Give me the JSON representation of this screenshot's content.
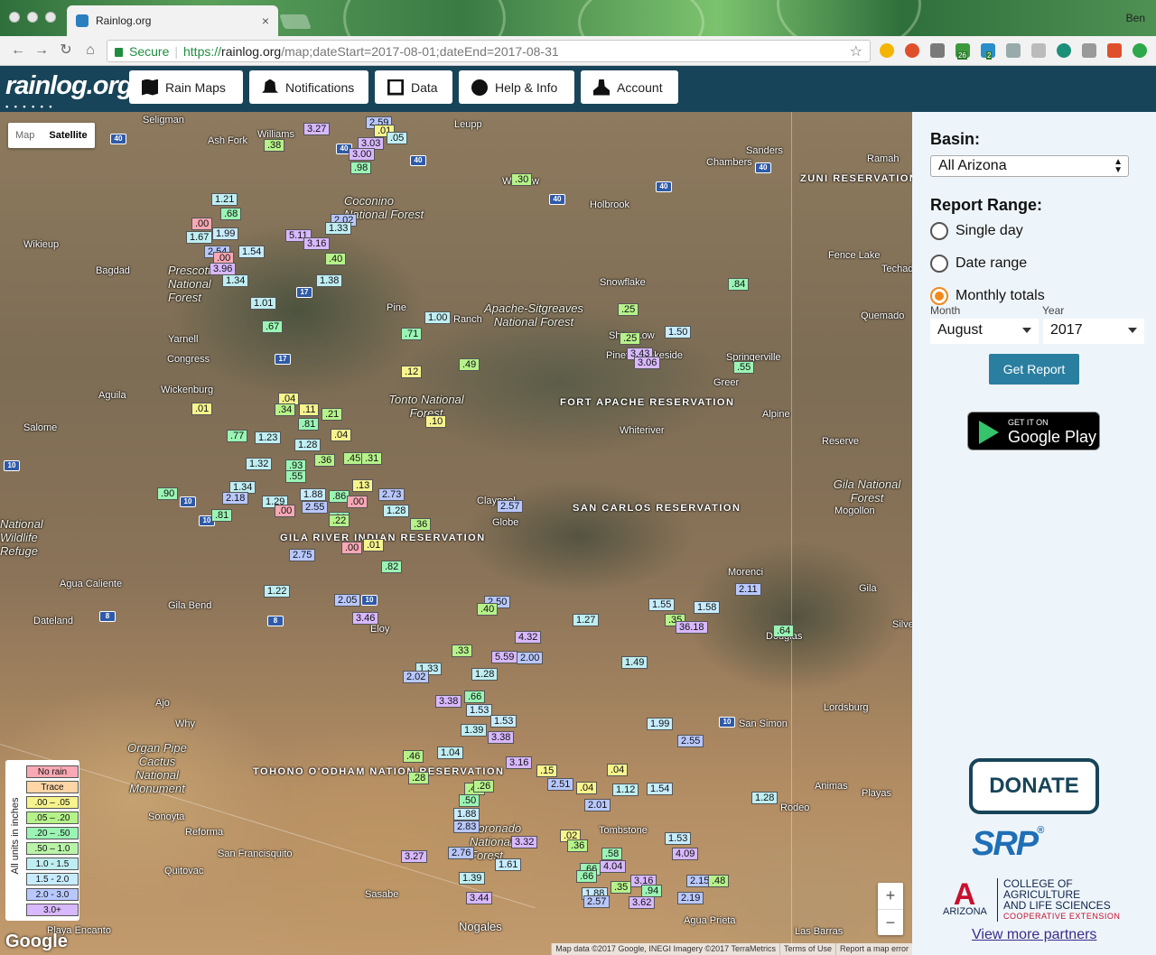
{
  "browser": {
    "tab_title": "Rainlog.org",
    "tab_close": "×",
    "user": "Ben",
    "secure_label": "Secure",
    "url_scheme": "https://",
    "url_host": "rainlog.org",
    "url_path": "/map;dateStart=2017-08-01;dateEnd=2017-08-31",
    "star": "☆",
    "back": "←",
    "forward": "→",
    "reload": "↻",
    "home": "⌂",
    "badge_a": "26",
    "badge_b": "2"
  },
  "header": {
    "logo": "rainlog.org",
    "logo_dots": "•  •  •  •  •  •",
    "nav": [
      "Rain Maps",
      "Notifications",
      "Data",
      "Help & Info",
      "Account"
    ]
  },
  "map": {
    "type_map": "Map",
    "type_satellite": "Satellite",
    "legend_title": "All units in inches",
    "legend": [
      "No rain",
      "Trace",
      ".00 – .05",
      ".05 – .20",
      ".20 – .50",
      ".50 – 1.0",
      "1.0 - 1.5",
      "1.5 - 2.0",
      "2.0 - 3.0",
      "3.0+"
    ],
    "google": "Google",
    "zoom_in": "+",
    "zoom_out": "−",
    "attribution": [
      "Map data ©2017 Google, INEGI Imagery ©2017 TerraMetrics",
      "Terms of Use",
      "Report a map error"
    ],
    "places": [
      "Seligman",
      "Ash Fork",
      "Williams",
      "Leupp",
      "Sanders",
      "Chambers",
      "Ramah",
      "Winslow",
      "Holbrook",
      "Wikieup",
      "Bagdad",
      "Coconino National Forest",
      "Snowflake",
      "Fence Lake",
      "Techado",
      "Apache-Sitgreaves National Forest",
      "Quemado",
      "Pine",
      "Ranch",
      "Show Low",
      "Pinetop-Lakeside",
      "Springerville",
      "Greer",
      "Yarnell",
      "Congress",
      "Wickenburg",
      "Aguila",
      "Tonto National Forest",
      "Salome",
      "Alpine",
      "Reserve",
      "Whiteriver",
      "Globe",
      "Claypool",
      "Gila National Forest",
      "Mogollon",
      "Morenci",
      "Gila",
      "Agua Caliente",
      "Gila Bend",
      "Dateland",
      "Ajo",
      "Why",
      "Eloy",
      "Organ Pipe Cactus National Monument",
      "Sonoyta",
      "Reforma",
      "San Francisquito",
      "Quitovac",
      "Sasabe",
      "Nogales",
      "Playa Encanto",
      "Tombstone",
      "Agua Prieta",
      "Las Barras",
      "Lordsburg",
      "San Simon",
      "Animas",
      "Playas",
      "Rodeo",
      "Douglas",
      "Silver",
      "Prescott National Forest",
      "National Wildlife Refuge",
      "Coronado National Forest"
    ],
    "reservations": [
      "ZUNI RESERVATION",
      "FORT APACHE RESERVATION",
      "SAN CARLOS RESERVATION",
      "GILA RIVER INDIAN RESERVATION",
      "TOHONO O'ODHAM NATION RESERVATION"
    ],
    "shields": [
      "40",
      "40",
      "40",
      "40",
      "40",
      "40",
      "17",
      "17",
      "10",
      "10",
      "10",
      "10",
      "8",
      "8",
      "10"
    ]
  },
  "readings": [
    {
      "v": "3.27",
      "c": "g"
    },
    {
      "v": "2.59",
      "c": "f"
    },
    {
      "v": ".01",
      "c": "a"
    },
    {
      "v": "3.03",
      "c": "g"
    },
    {
      "v": ".05",
      "c": "d"
    },
    {
      "v": ".38",
      "c": "b"
    },
    {
      "v": "3.00",
      "c": "g"
    },
    {
      "v": ".98",
      "c": "c"
    },
    {
      "v": ".30",
      "c": "b"
    },
    {
      "v": "1.21",
      "c": "d"
    },
    {
      "v": ".68",
      "c": "c"
    },
    {
      "v": "2.02",
      "c": "f"
    },
    {
      "v": "1.33",
      "c": "d"
    },
    {
      "v": ".00",
      "c": "none"
    },
    {
      "v": "1.67",
      "c": "d"
    },
    {
      "v": "1.99",
      "c": "e"
    },
    {
      "v": "5.11",
      "c": "g"
    },
    {
      "v": "3.16",
      "c": "g"
    },
    {
      "v": "2.54",
      "c": "f"
    },
    {
      "v": "1.54",
      "c": "e"
    },
    {
      "v": ".00",
      "c": "none"
    },
    {
      "v": ".40",
      "c": "b"
    },
    {
      "v": "3.96",
      "c": "g"
    },
    {
      "v": "1.34",
      "c": "d"
    },
    {
      "v": "1.38",
      "c": "d"
    },
    {
      "v": ".84",
      "c": "c"
    },
    {
      "v": "1.01",
      "c": "d"
    },
    {
      "v": ".25",
      "c": "b"
    },
    {
      "v": "1.00",
      "c": "d"
    },
    {
      "v": ".67",
      "c": "c"
    },
    {
      "v": ".71",
      "c": "c"
    },
    {
      "v": "3.43",
      "c": "g"
    },
    {
      "v": "1.50",
      "c": "e"
    },
    {
      "v": ".25",
      "c": "b"
    },
    {
      "v": "3.06",
      "c": "g"
    },
    {
      "v": ".12",
      "c": "a"
    },
    {
      "v": ".49",
      "c": "b"
    },
    {
      "v": ".55",
      "c": "c"
    },
    {
      "v": ".04",
      "c": "a"
    },
    {
      "v": ".34",
      "c": "b"
    },
    {
      "v": ".11",
      "c": "a"
    },
    {
      "v": ".21",
      "c": "b"
    },
    {
      "v": ".81",
      "c": "c"
    },
    {
      "v": ".01",
      "c": "a"
    },
    {
      "v": ".10",
      "c": "a"
    },
    {
      "v": ".77",
      "c": "c"
    },
    {
      "v": "1.23",
      "c": "d"
    },
    {
      "v": ".04",
      "c": "a"
    },
    {
      "v": "1.28",
      "c": "d"
    },
    {
      "v": ".45",
      "c": "b"
    },
    {
      "v": ".31",
      "c": "b"
    },
    {
      "v": "1.32",
      "c": "d"
    },
    {
      "v": ".93",
      "c": "c"
    },
    {
      "v": ".36",
      "c": "b"
    },
    {
      "v": ".55",
      "c": "c"
    },
    {
      "v": "1.34",
      "c": "d"
    },
    {
      "v": "1.88",
      "c": "e"
    },
    {
      "v": ".86",
      "c": "c"
    },
    {
      "v": ".13",
      "c": "a"
    },
    {
      "v": "2.73",
      "c": "f"
    },
    {
      "v": ".90",
      "c": "c"
    },
    {
      "v": "2.18",
      "c": "f"
    },
    {
      "v": "1.29",
      "c": "d"
    },
    {
      "v": ".00",
      "c": "none"
    },
    {
      "v": "2.55",
      "c": "f"
    },
    {
      "v": ".00",
      "c": "none"
    },
    {
      "v": ".81",
      "c": "c"
    },
    {
      "v": "1.28",
      "c": "d"
    },
    {
      "v": ".36",
      "c": "b"
    },
    {
      "v": ".81",
      "c": "c"
    },
    {
      "v": ".22",
      "c": "b"
    },
    {
      "v": "2.57",
      "c": "f"
    },
    {
      "v": ".00",
      "c": "none"
    },
    {
      "v": ".01",
      "c": "a"
    },
    {
      "v": "2.75",
      "c": "f"
    },
    {
      "v": ".82",
      "c": "c"
    },
    {
      "v": "2.11",
      "c": "f"
    },
    {
      "v": "1.22",
      "c": "d"
    },
    {
      "v": "2.05",
      "c": "f"
    },
    {
      "v": "2.50",
      "c": "f"
    },
    {
      "v": ".40",
      "c": "b"
    },
    {
      "v": "1.55",
      "c": "e"
    },
    {
      "v": "1.58",
      "c": "e"
    },
    {
      "v": "1.27",
      "c": "d"
    },
    {
      "v": "3.46",
      "c": "g"
    },
    {
      "v": ".35",
      "c": "b"
    },
    {
      "v": "36.18",
      "c": "g"
    },
    {
      "v": ".64",
      "c": "c"
    },
    {
      "v": "4.32",
      "c": "g"
    },
    {
      "v": ".33",
      "c": "b"
    },
    {
      "v": "5.59",
      "c": "g"
    },
    {
      "v": "2.00",
      "c": "f"
    },
    {
      "v": "1.49",
      "c": "d"
    },
    {
      "v": "1.33",
      "c": "d"
    },
    {
      "v": "1.28",
      "c": "d"
    },
    {
      "v": "2.02",
      "c": "f"
    },
    {
      "v": ".66",
      "c": "c"
    },
    {
      "v": "3.38",
      "c": "g"
    },
    {
      "v": "1.53",
      "c": "e"
    },
    {
      "v": "1.53",
      "c": "e"
    },
    {
      "v": "1.99",
      "c": "e"
    },
    {
      "v": "1.39",
      "c": "d"
    },
    {
      "v": "2.55",
      "c": "f"
    },
    {
      "v": "3.38",
      "c": "g"
    },
    {
      "v": "1.04",
      "c": "d"
    },
    {
      "v": ".46",
      "c": "b"
    },
    {
      "v": "3.16",
      "c": "g"
    },
    {
      "v": ".15",
      "c": "a"
    },
    {
      "v": ".28",
      "c": "b"
    },
    {
      "v": ".04",
      "c": "a"
    },
    {
      "v": ".46",
      "c": "b"
    },
    {
      "v": ".26",
      "c": "b"
    },
    {
      "v": "2.51",
      "c": "f"
    },
    {
      "v": ".04",
      "c": "a"
    },
    {
      "v": "1.12",
      "c": "d"
    },
    {
      "v": "1.54",
      "c": "e"
    },
    {
      "v": "1.28",
      "c": "d"
    },
    {
      "v": ".50",
      "c": "c"
    },
    {
      "v": "2.01",
      "c": "f"
    },
    {
      "v": "1.88",
      "c": "e"
    },
    {
      "v": "2.83",
      "c": "f"
    },
    {
      "v": ".02",
      "c": "a"
    },
    {
      "v": "3.32",
      "c": "g"
    },
    {
      "v": ".36",
      "c": "b"
    },
    {
      "v": "1.53",
      "c": "e"
    },
    {
      "v": "2.76",
      "c": "f"
    },
    {
      "v": "3.27",
      "c": "g"
    },
    {
      "v": "1.61",
      "c": "e"
    },
    {
      "v": ".58",
      "c": "c"
    },
    {
      "v": "4.09",
      "c": "g"
    },
    {
      "v": "4.04",
      "c": "g"
    },
    {
      "v": "1.39",
      "c": "d"
    },
    {
      "v": ".66",
      "c": "c"
    },
    {
      "v": "3.16",
      "c": "g"
    },
    {
      "v": "2.15",
      "c": "f"
    },
    {
      "v": ".48",
      "c": "b"
    },
    {
      "v": ".66",
      "c": "c"
    },
    {
      "v": "1.88",
      "c": "e"
    },
    {
      "v": ".35",
      "c": "b"
    },
    {
      "v": ".94",
      "c": "c"
    },
    {
      "v": "3.44",
      "c": "g"
    },
    {
      "v": "2.57",
      "c": "f"
    },
    {
      "v": "3.62",
      "c": "g"
    },
    {
      "v": "2.19",
      "c": "f"
    }
  ],
  "sidebar": {
    "basin_label": "Basin:",
    "basin_value": "All Arizona",
    "range_label": "Report Range:",
    "opt_single": "Single day",
    "opt_range": "Date range",
    "opt_monthly": "Monthly totals",
    "month_label": "Month",
    "year_label": "Year",
    "month_value": "August",
    "year_value": "2017",
    "get_report": "Get Report",
    "gplay_top": "GET IT ON",
    "gplay_main": "Google Play",
    "donate": "DONATE",
    "srp": "SRP",
    "srp_reg": "®",
    "az_letter": "A",
    "az_name": "ARIZONA",
    "cals_line1": "COLLEGE OF AGRICULTURE",
    "cals_line2": "AND LIFE SCIENCES",
    "cals_line3": "COOPERATIVE EXTENSION",
    "partners": "View more partners"
  }
}
